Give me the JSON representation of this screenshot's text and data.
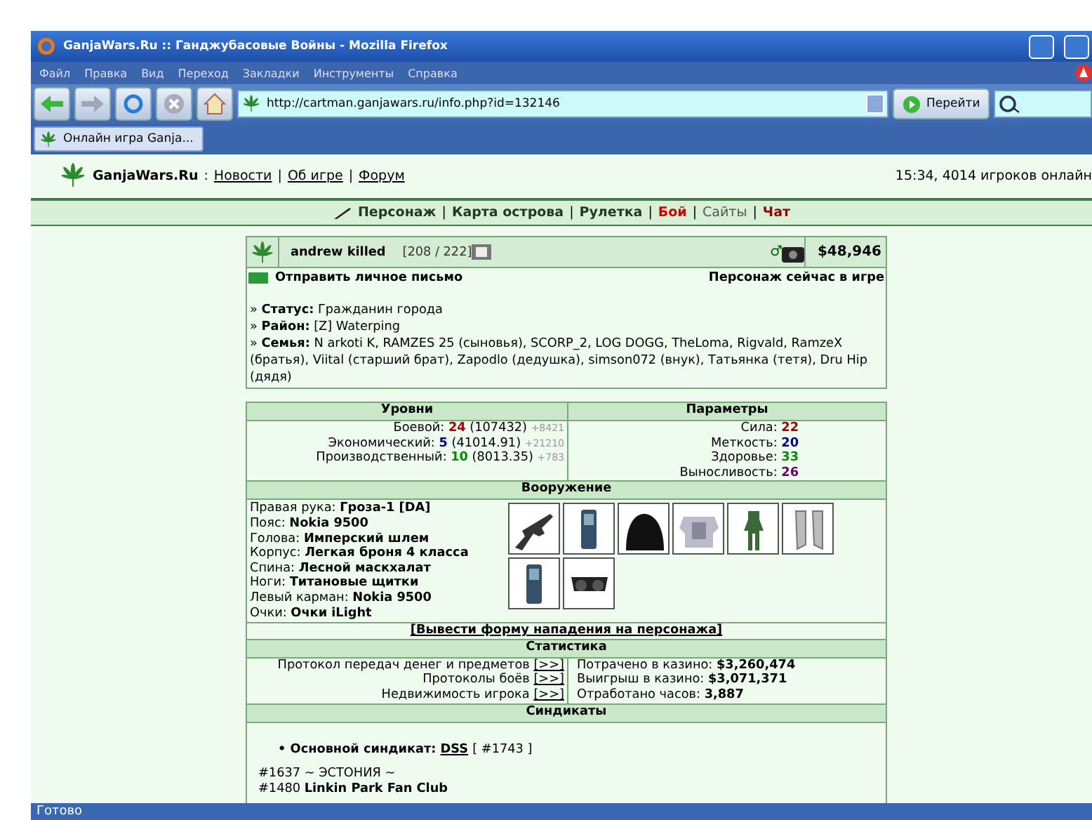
{
  "window": {
    "title": "GanjaWars.Ru :: Ганджубасовые Войны - Mozilla Firefox"
  },
  "menu": [
    "Файл",
    "Правка",
    "Вид",
    "Переход",
    "Закладки",
    "Инструменты",
    "Справка"
  ],
  "toolbar": {
    "address": "http://cartman.ganjawars.ru/info.php?id=132146",
    "go_button": "Перейти"
  },
  "tabs": [
    {
      "label": "Онлайн игра Ganja...",
      "selected": true
    }
  ],
  "site_header": {
    "site_name": "GanjaWars.Ru",
    "separator": ":",
    "links": [
      "Новости",
      "Об игре",
      "Форум"
    ],
    "link_separator": "|",
    "online": "15:34, 4014 игроков онлайн"
  },
  "nav": {
    "separator": "|",
    "items": [
      {
        "label": "Персонаж",
        "color": "#1f3a1f",
        "bold": true
      },
      {
        "label": "Карта острова",
        "color": "#1f3a1f",
        "bold": true
      },
      {
        "label": "Рулетка",
        "color": "#1f3a1f",
        "bold": true
      },
      {
        "label": "Бой",
        "color": "#cc0000",
        "bold": true
      },
      {
        "label": "Сайты",
        "color": "#555555",
        "bold": false
      },
      {
        "label": "Чат",
        "color": "#990000",
        "bold": true
      }
    ]
  },
  "profile": {
    "name": "andrew killed",
    "hp": "[208 / 222]",
    "gender_sign": "♂",
    "money": "$48,946",
    "send_message": "Отправить личное письмо",
    "online_status": "Персонаж сейчас в игре",
    "info": [
      "» **Статус:** Гражданин города",
      "» **Район:** [Z] Waterping",
      "» **Семья:** N arkoti K, RAMZES 25 (сыновья), SCORP_2, LOG DOGG, TheLoma, Rigvald, RamzeX (братья), Viital (старший брат), Zapodlo (дедушка), simson072 (внук), Татьянка (тетя), Dru Hip (дядя)"
    ]
  },
  "levels": {
    "title": "Уровни",
    "rows": [
      {
        "label": "Боевой:",
        "value": "24",
        "color": "#aa0000",
        "exp": "(107432)",
        "gain": "+8421"
      },
      {
        "label": "Экономический:",
        "value": "5",
        "color": "#000080",
        "exp": "(41014.91)",
        "gain": "+21210"
      },
      {
        "label": "Производственный:",
        "value": "10",
        "color": "#008800",
        "exp": "(8013.35)",
        "gain": "+783"
      }
    ]
  },
  "parameters": {
    "title": "Параметры",
    "rows": [
      {
        "label": "Сила:",
        "value": "22",
        "color": "#990000"
      },
      {
        "label": "Меткость:",
        "value": "20",
        "color": "#000080"
      },
      {
        "label": "Здоровье:",
        "value": "33",
        "color": "#008800"
      },
      {
        "label": "Выносливость:",
        "value": "26",
        "color": "#660066"
      }
    ]
  },
  "equipment": {
    "title": "Вооружение",
    "slots": [
      {
        "label": "Правая рука:",
        "item": "Гроза-1 [DA]"
      },
      {
        "label": "Пояс:",
        "item": "Nokia 9500"
      },
      {
        "label": "Голова:",
        "item": "Имперский шлем"
      },
      {
        "label": "Корпус:",
        "item": "Легкая броня 4 класса"
      },
      {
        "label": "Спина:",
        "item": "Лесной маскхалат"
      },
      {
        "label": "Ноги:",
        "item": "Титановые щитки"
      },
      {
        "label": "Левый карман:",
        "item": "Nokia 9500"
      },
      {
        "label": "Очки:",
        "item": "Очки iLight"
      }
    ],
    "attack_link": "[Вывести форму нападения на персонажа]"
  },
  "statistics": {
    "title": "Статистика",
    "logs": [
      {
        "label": "Протокол передач денег и предметов",
        "link": "[>>]"
      },
      {
        "label": "Протоколы боёв",
        "link": "[>>]"
      },
      {
        "label": "Недвижимость игрока",
        "link": "[>>]"
      }
    ],
    "totals": [
      {
        "label": "Потрачено в казино:",
        "value": "$3,260,474"
      },
      {
        "label": "Выигрыш в казино:",
        "value": "$3,071,371"
      },
      {
        "label": "Отработано часов:",
        "value": "3,887"
      }
    ]
  },
  "syndicates": {
    "title": "Синдикаты",
    "main": {
      "bullet": "•",
      "label": "Основной синдикат:",
      "name": "DSS",
      "id": "[ #1743 ]"
    },
    "list": [
      "#1637 ~ ЭСТОНИЯ ~",
      "#1480 **Linkin Park Fan Club**"
    ]
  },
  "status_bar": "Готово"
}
